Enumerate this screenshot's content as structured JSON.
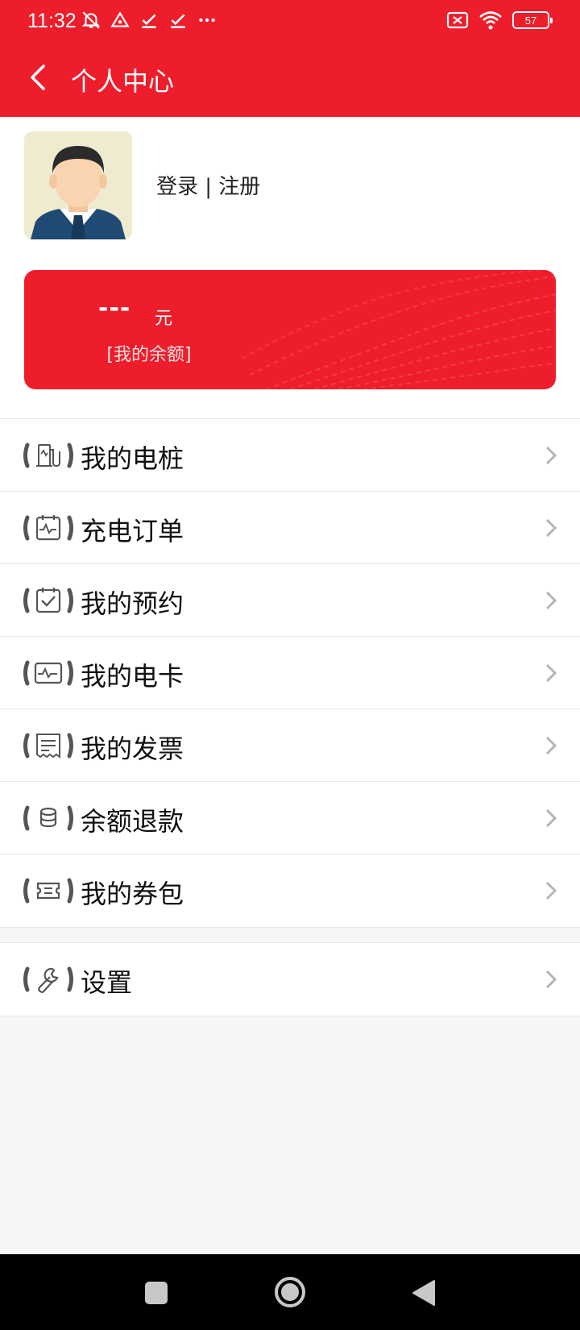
{
  "status": {
    "time": "11:32",
    "battery": "57"
  },
  "header": {
    "title": "个人中心"
  },
  "profile": {
    "login_text": "登录 | 注册"
  },
  "balance": {
    "amount": "---",
    "unit": "元",
    "label": "[我的余额]"
  },
  "menu": [
    {
      "label": "我的电桩",
      "icon": "charging-pile-icon"
    },
    {
      "label": "充电订单",
      "icon": "order-icon"
    },
    {
      "label": "我的预约",
      "icon": "reservation-icon"
    },
    {
      "label": "我的电卡",
      "icon": "card-icon"
    },
    {
      "label": "我的发票",
      "icon": "invoice-icon"
    },
    {
      "label": "余额退款",
      "icon": "refund-icon"
    },
    {
      "label": "我的券包",
      "icon": "coupon-icon"
    }
  ],
  "settings": {
    "label": "设置",
    "icon": "settings-icon"
  },
  "colors": {
    "primary": "#ee1d2b",
    "background": "#f6f6f6"
  }
}
